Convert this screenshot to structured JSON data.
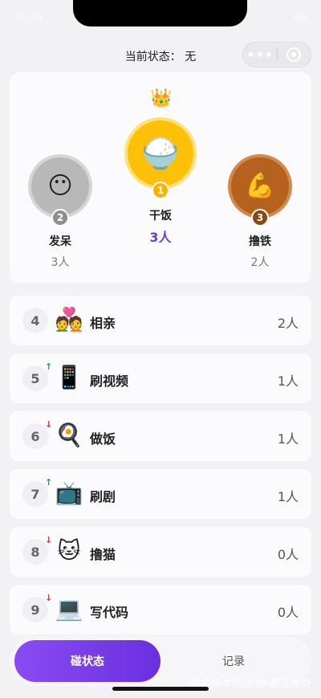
{
  "status_bar": {
    "time": "19:38",
    "right": "4G"
  },
  "header": {
    "title": "当前状态： 无"
  },
  "podium": {
    "crown_icon": "crown-icon",
    "first": {
      "rank": "1",
      "emoji": "🍚",
      "name": "干饭",
      "count": "3人",
      "color": "#ffc107"
    },
    "second": {
      "rank": "2",
      "emoji": "😶",
      "name": "发呆",
      "count": "3人",
      "color": "#b8b8b8"
    },
    "third": {
      "rank": "3",
      "emoji": "💪",
      "name": "撸铁",
      "count": "2人",
      "color": "#b5621e"
    }
  },
  "list": [
    {
      "rank": "4",
      "trend": "",
      "emoji": "💑",
      "name": "相亲",
      "count": "2人"
    },
    {
      "rank": "5",
      "trend": "↑",
      "emoji": "📱",
      "name": "刷视频",
      "count": "1人"
    },
    {
      "rank": "6",
      "trend": "↓",
      "emoji": "🍳",
      "name": "做饭",
      "count": "1人"
    },
    {
      "rank": "7",
      "trend": "↑",
      "emoji": "📺",
      "name": "刷剧",
      "count": "1人"
    },
    {
      "rank": "8",
      "trend": "↓",
      "emoji": "🐱",
      "name": "撸猫",
      "count": "0人"
    },
    {
      "rank": "9",
      "trend": "↓",
      "emoji": "💻",
      "name": "写代码",
      "count": "0人"
    }
  ],
  "colors": {
    "trend_up": "#2e9e57",
    "trend_down": "#d93a3a",
    "accent": "#7a3cf0",
    "first_count": "#6a3fd6"
  },
  "tabs": {
    "active": "碰状态",
    "inactive": "记录"
  },
  "watermark": "掘金技术社区 @ 是江迪呀"
}
